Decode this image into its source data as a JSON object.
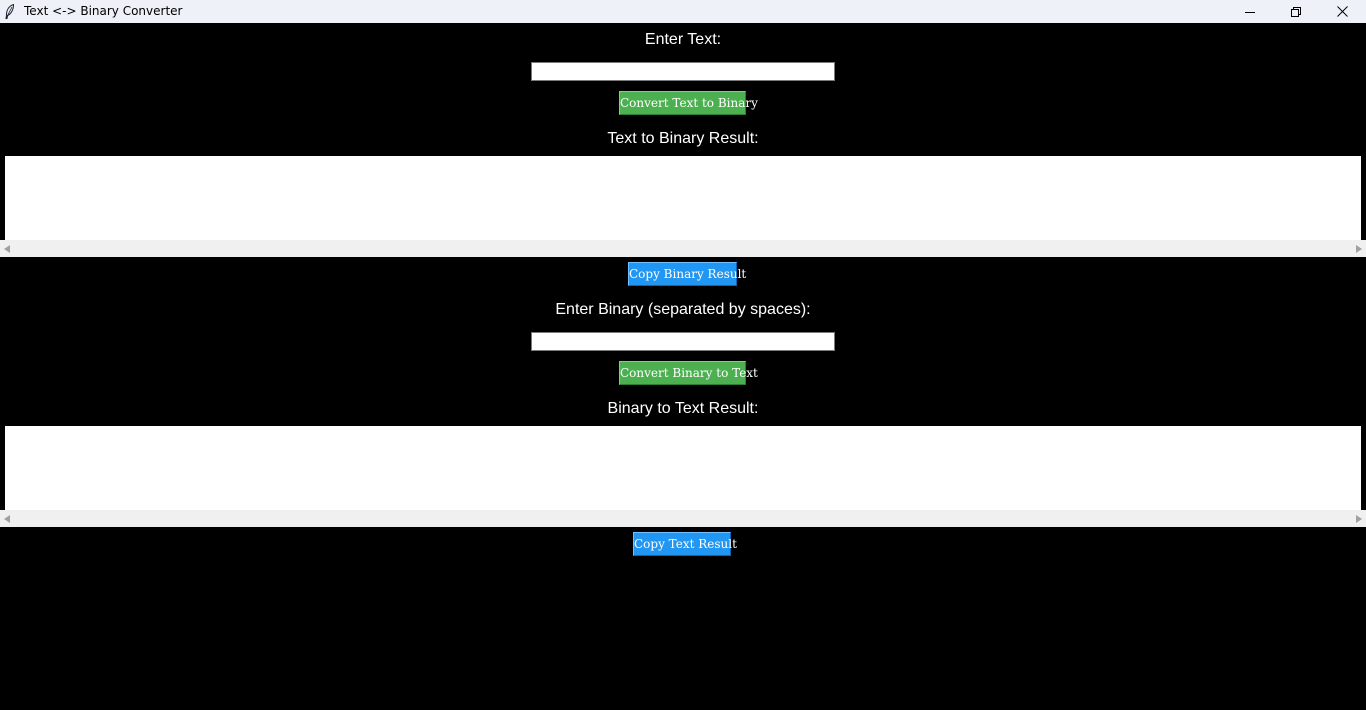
{
  "window": {
    "title": "Text <-> Binary Converter",
    "icon": "feather-icon"
  },
  "text_to_binary": {
    "prompt_label": "Enter Text:",
    "input_value": "",
    "convert_button_label": "Convert Text to Binary",
    "result_label": "Text to Binary Result:",
    "result_value": "",
    "copy_button_label": "Copy Binary Result"
  },
  "binary_to_text": {
    "prompt_label": "Enter Binary (separated by spaces):",
    "input_value": "",
    "convert_button_label": "Convert Binary to Text",
    "result_label": "Binary to Text Result:",
    "result_value": "",
    "copy_button_label": "Copy Text Result"
  },
  "colors": {
    "background": "#000000",
    "convert_button": "#4caf50",
    "copy_button": "#2196f3",
    "titlebar": "#eef1f8"
  }
}
